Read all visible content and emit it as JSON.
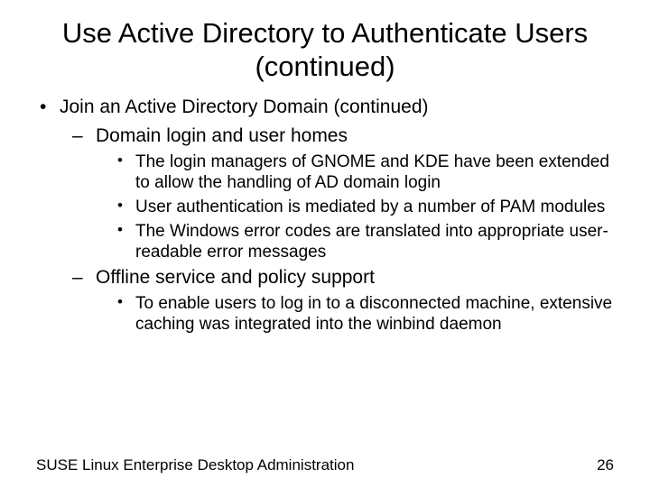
{
  "title": "Use Active Directory to Authenticate Users (continued)",
  "b1": "Join an Active Directory Domain (continued)",
  "s1": "Domain login and user homes",
  "s1a": "The login managers of GNOME and KDE have been extended to allow the handling of AD domain login",
  "s1b": "User authentication is mediated by a number of PAM modules",
  "s1c": "The Windows error codes are translated into appropriate user-readable error messages",
  "s2": "Offline service and policy support",
  "s2a": "To enable users to log in to a disconnected machine, extensive caching was integrated into the winbind daemon",
  "footer_left": "SUSE Linux Enterprise Desktop Administration",
  "footer_right": "26"
}
